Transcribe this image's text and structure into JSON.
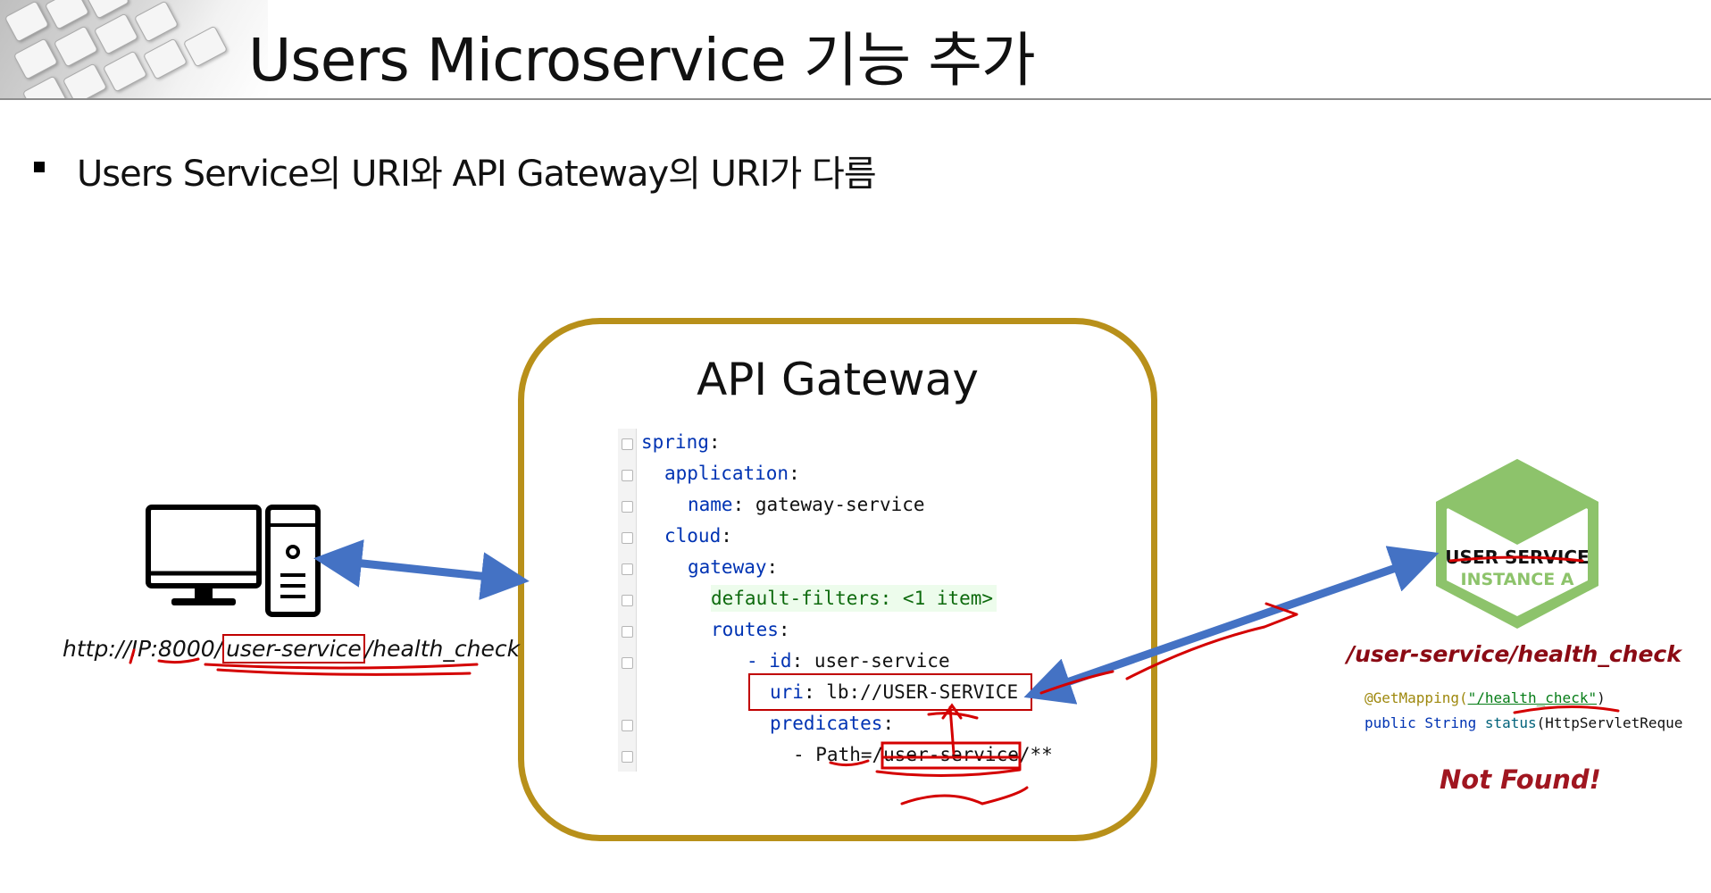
{
  "title": "Users Microservice 기능 추가",
  "bullet": "Users Service의 URI와 API Gateway의 URI가 다름",
  "gateway": {
    "title": "API Gateway",
    "code": [
      {
        "key": "spring",
        "sep": ":",
        "value": ""
      },
      {
        "key": "application",
        "sep": ":",
        "value": ""
      },
      {
        "key": "name",
        "sep": ":",
        "value": " gateway-service"
      },
      {
        "key": "cloud",
        "sep": ":",
        "value": ""
      },
      {
        "key": "gateway",
        "sep": ":",
        "value": ""
      },
      {
        "key": "default-filters: <1 item>",
        "sep": "",
        "value": ""
      },
      {
        "key": "routes",
        "sep": ":",
        "value": ""
      },
      {
        "key": "- id",
        "sep": ":",
        "value": " user-service"
      },
      {
        "key": "uri",
        "sep": ":",
        "value": " lb://USER-SERVICE"
      },
      {
        "key": "predicates",
        "sep": ":",
        "value": ""
      },
      {
        "key": "- Path=/user-service/**",
        "sep": "",
        "value": ""
      }
    ]
  },
  "client": {
    "url_prefix": "http://IP:8000/",
    "url_highlight": "user-service",
    "url_suffix": "/health_check"
  },
  "service": {
    "name": "USER SERVICE",
    "instance": "INSTANCE A",
    "path": "/user-service/health_check",
    "annotation": "@GetMapping(",
    "annotation_value": "\"/health_check\"",
    "annotation_end": ")",
    "method_kw": "public String ",
    "method_name": "status",
    "method_args": "(HttpServletReque",
    "result": "Not Found!"
  },
  "colors": {
    "gateway_border": "#b8901a",
    "arrow": "#4472c4",
    "annotation_red": "#c00000",
    "hexagon_green": "#8dc36b",
    "service_text": "#8b0a14"
  }
}
